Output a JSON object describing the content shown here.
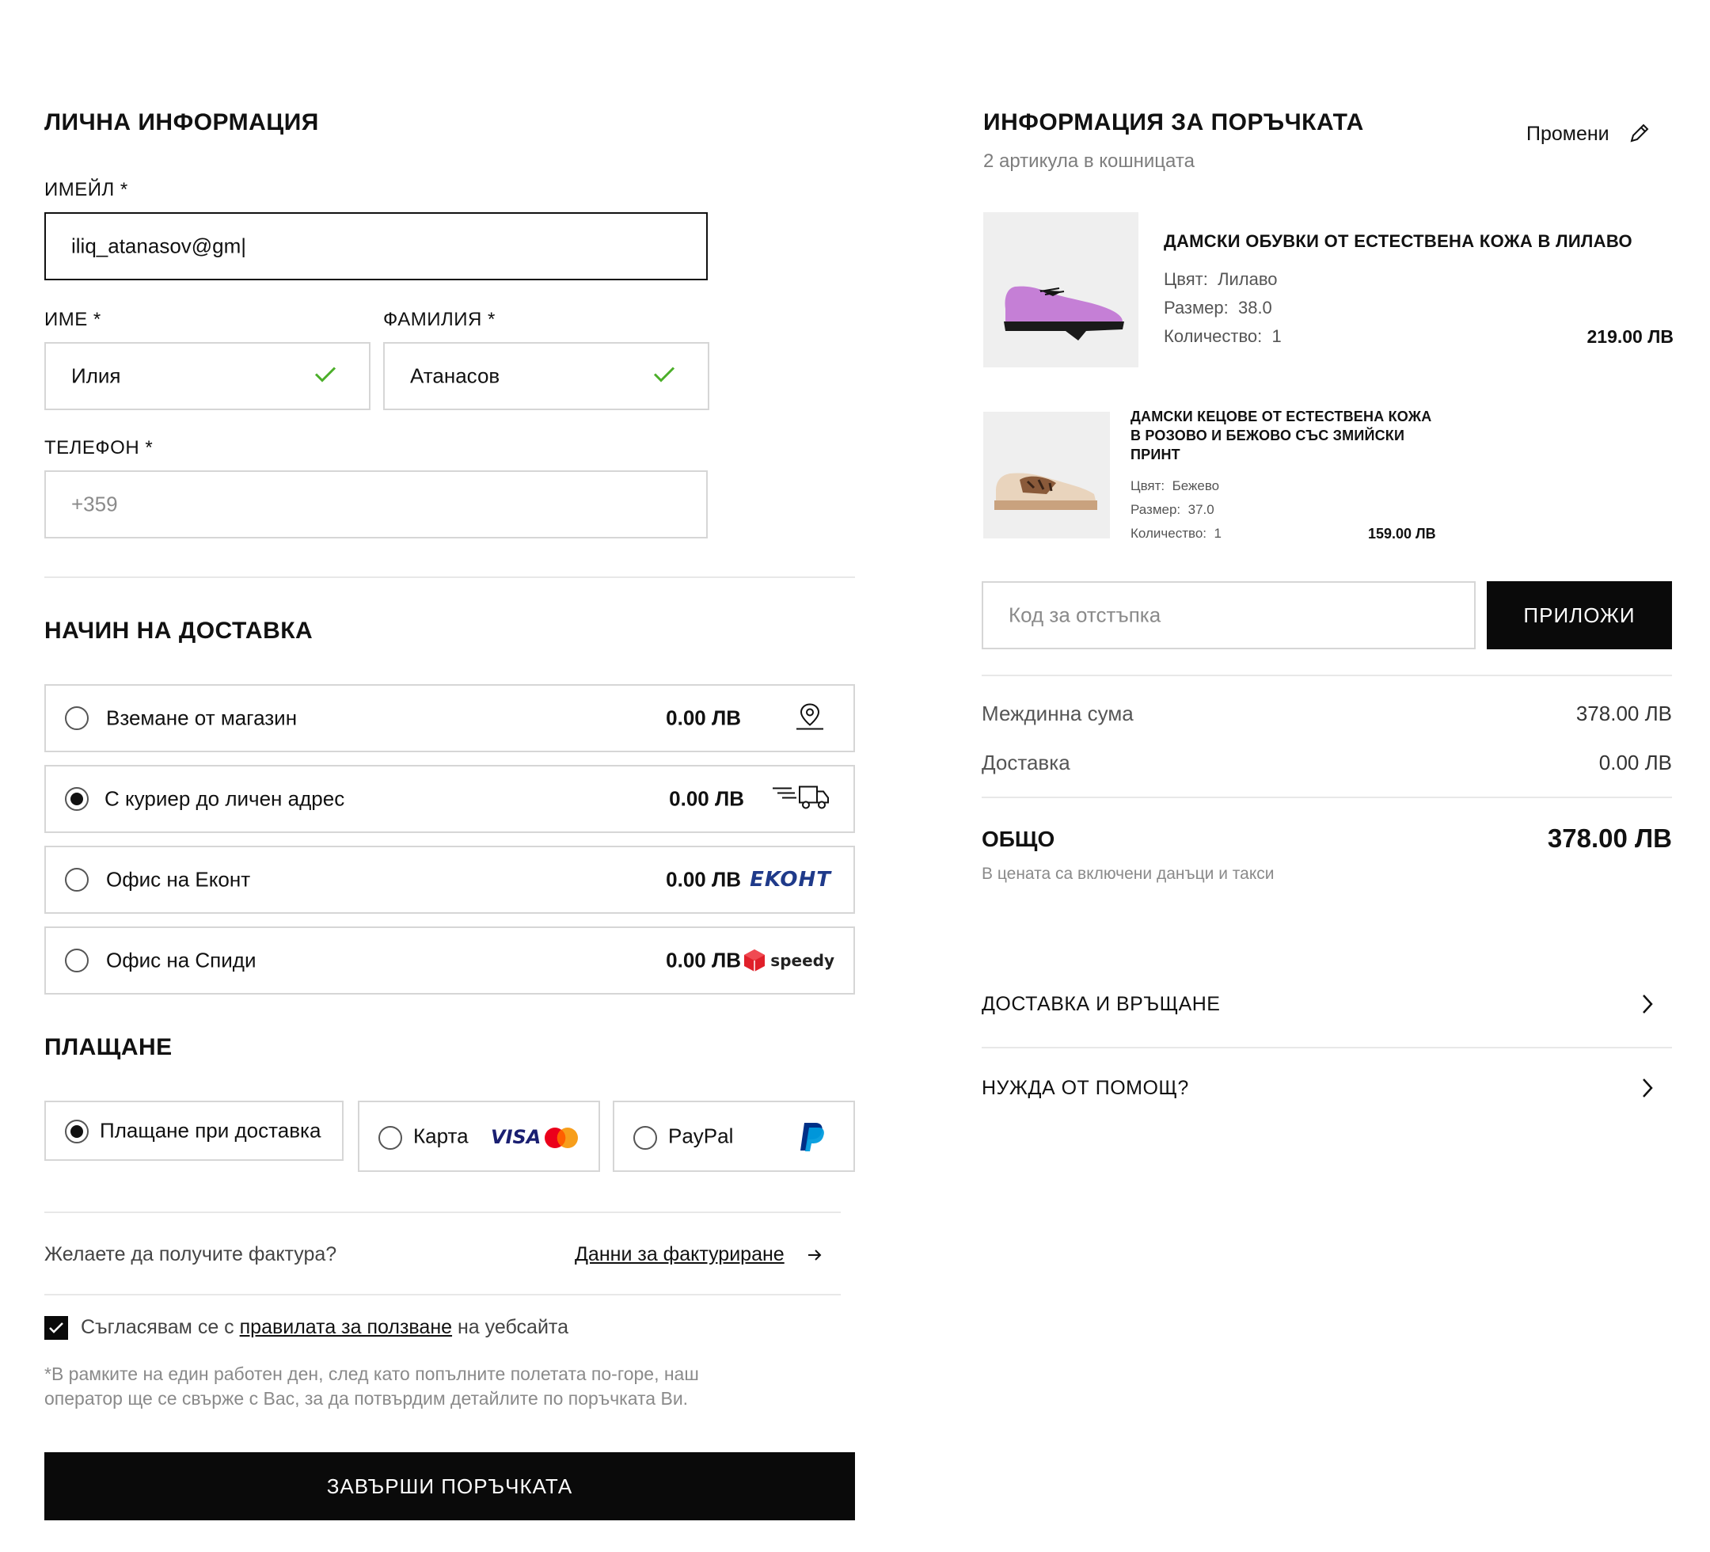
{
  "personal": {
    "title": "ЛИЧНА ИНФОРМАЦИЯ",
    "email_label": "ИМЕЙЛ *",
    "email_value": "iliq_atanasov@gm|",
    "first_name_label": "ИМЕ *",
    "first_name_value": "Илия",
    "last_name_label": "ФАМИЛИЯ *",
    "last_name_value": "Атанасов",
    "phone_label": "ТЕЛЕФОН *",
    "phone_placeholder": "+359"
  },
  "delivery": {
    "title": "НАЧИН НА ДОСТАВКА",
    "options": [
      {
        "name": "Вземане от магазин",
        "price": "0.00 ЛВ",
        "icon": "location-pin-icon",
        "selected": false
      },
      {
        "name": "С куриер до личен адрес",
        "price": "0.00 ЛВ",
        "icon": "delivery-truck-icon",
        "selected": true
      },
      {
        "name": "Офис на Еконт",
        "price": "0.00 ЛВ",
        "icon": "econt-logo",
        "logo_text": "EKOHT",
        "selected": false
      },
      {
        "name": "Офис на Спиди",
        "price": "0.00 ЛВ",
        "icon": "speedy-logo",
        "logo_text": "speedy",
        "selected": false
      }
    ]
  },
  "payment": {
    "title": "ПЛАЩАНЕ",
    "options": [
      {
        "name": "Плащане при доставка",
        "selected": true
      },
      {
        "name": "Карта",
        "logo_text": "VISA",
        "selected": false
      },
      {
        "name": "PayPal",
        "selected": false
      }
    ]
  },
  "invoice": {
    "question": "Желаете да получите фактура?",
    "link": "Данни за фактуриране"
  },
  "terms": {
    "prefix": "Съгласявам се с",
    "link": "правилата за ползване",
    "suffix": "на уебсайта",
    "checked": true
  },
  "note": {
    "line1": "*В рамките на един работен ден, след като попълните полетата по-горе, наш",
    "line2": "оператор ще се свърже с Вас, за да потвърдим детайлите по поръчката Ви."
  },
  "submit_label": "ЗАВЪРШИ ПОРЪЧКАТА",
  "order": {
    "title": "ИНФОРМАЦИЯ ЗА ПОРЪЧКАТА",
    "subtitle": "2 артикула в кошницата",
    "edit_label": "Промени",
    "items": [
      {
        "title": "ДАМСКИ ОБУВКИ ОТ ЕСТЕСТВЕНА КОЖА В ЛИЛАВО",
        "color_label": "Цвят:",
        "color_value": "Лилаво",
        "size_label": "Размер:",
        "size_value": "38.0",
        "qty_label": "Количество:",
        "qty_value": "1",
        "price": "219.00 ЛВ"
      },
      {
        "title_line1": "ДАМСКИ КЕЦОВЕ ОТ ЕСТЕСТВЕНА КОЖА",
        "title_line2": "В РОЗОВО И БЕЖОВО СЪС ЗМИЙСКИ",
        "title_line3": "ПРИНТ",
        "color_label": "Цвят:",
        "color_value": "Бежево",
        "size_label": "Размер:",
        "size_value": "37.0",
        "qty_label": "Количество:",
        "qty_value": "1",
        "price": "159.00 ЛВ"
      }
    ],
    "discount_placeholder": "Код за отстъпка",
    "apply_label": "ПРИЛОЖИ",
    "subtotal_label": "Междинна сума",
    "subtotal_value": "378.00 ЛВ",
    "shipping_label": "Доставка",
    "shipping_value": "0.00 ЛВ",
    "total_label": "ОБЩО",
    "total_value": "378.00 ЛВ",
    "tax_note": "В цената са включени данъци и такси",
    "accordions": [
      {
        "label": "ДОСТАВКА И ВРЪЩАНЕ"
      },
      {
        "label": "НУЖДА ОТ ПОМОЩ?"
      }
    ]
  },
  "colors": {
    "accent_black": "#0a0a0a",
    "check_green": "#4caf2a",
    "econt_blue": "#1f3a8a",
    "speedy_red": "#e0202a",
    "visa_blue": "#1a1f71",
    "paypal_dark": "#003087",
    "paypal_light": "#009cde"
  }
}
